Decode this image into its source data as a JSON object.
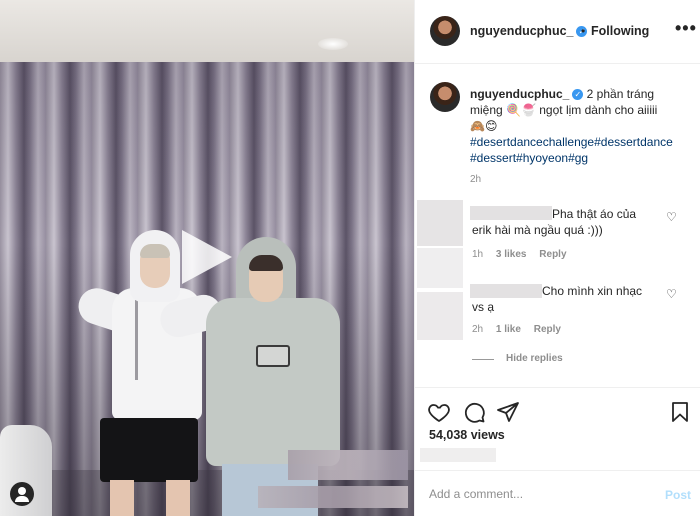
{
  "post": {
    "username": "nguyenducphuc_",
    "follow_separator": "•",
    "follow_status": "Following",
    "more_label": "•••",
    "verified_mark": "✓",
    "caption": {
      "username": "nguyenducphuc_",
      "line1": " 2 phần tráng miệng ",
      "line1b": " ngọt lịm dành cho aiiiii",
      "emoji": "🙈😊",
      "emoji_inline": "🍭🍧",
      "hashtags_line1": "#desertdancechallenge#dessertdance",
      "hashtags_line2": "#dessert#hyoyeon#gg",
      "time": "2h"
    },
    "comments": [
      {
        "text_part1": "Pha thật áo của",
        "text_part2": "erik hài mà ngầu quá :)))",
        "time": "1h",
        "likes": "3 likes",
        "reply": "Reply"
      },
      {
        "text_part1": "Cho mình xin nhạc",
        "text_part2": "vs ạ",
        "time": "2h",
        "likes": "1 like",
        "reply": "Reply"
      }
    ],
    "hide_replies": "Hide replies",
    "views": "54,038 views",
    "add_comment_placeholder": "Add a comment...",
    "post_button": "Post"
  },
  "icons": {
    "heart": "heart-icon",
    "comment": "comment-icon",
    "share": "paper-plane-icon",
    "save": "bookmark-icon",
    "play": "play-icon",
    "user_tag": "user-tag-icon"
  },
  "colors": {
    "verified": "#3897f0",
    "hashtag": "#003569",
    "post_button_disabled": "#b2dffc"
  }
}
